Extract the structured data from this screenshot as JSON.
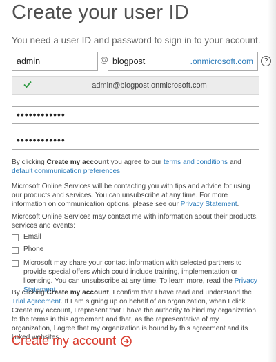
{
  "page": {
    "title": "Create your user ID",
    "subtitle": "You need a user ID and password to sign in to your account."
  },
  "form": {
    "username_value": "admin",
    "at_symbol": "@",
    "domain_value": "blogpost",
    "domain_suffix": ".onmicrosoft.com",
    "help_glyph": "?",
    "confirmed_id": "admin@blogpost.onmicrosoft.com",
    "password_mask": "••••••••••••",
    "confirm_password_mask": "••••••••••••"
  },
  "terms": {
    "pre": "By clicking ",
    "bold": "Create my account",
    "mid": " you agree to our ",
    "terms_link": "terms and conditions",
    "and": " and ",
    "default_link": "default communication preferences",
    "end": "."
  },
  "contact_notice": {
    "text": "Microsoft Online Services will be contacting you with tips and advice for using our products and services. You can unsubscribe at any time. For more information on communication options, please see our ",
    "privacy_link": "Privacy Statement",
    "end": "."
  },
  "contact_options": {
    "intro": "Microsoft Online Services may contact me with information about their products, services and events:",
    "email_label": "Email",
    "phone_label": "Phone",
    "share_text": "Microsoft may share your contact information with selected partners to provide special offers which could include training, implementation or licensing. You can unsubscribe at any time. To learn more, read the ",
    "share_privacy_link": "Privacy Statement",
    "share_end": "."
  },
  "agreement": {
    "pre": "By clicking ",
    "bold": "Create my account",
    "mid": ", I confirm that I have read and understand the ",
    "trial_link": "Trial Agreement",
    "rest": ". If I am signing up on behalf of an organization, when I click Create my account, I represent that I have the authority to bind my organization to the terms in this agreement and that, as the representative of my organization, I agree that my organization is bound by this agreement and its linked websites."
  },
  "actions": {
    "create_label": "Create my account"
  },
  "colors": {
    "accent_red": "#d9382a",
    "link_blue": "#2a7ab9",
    "check_green": "#2e9a43"
  }
}
